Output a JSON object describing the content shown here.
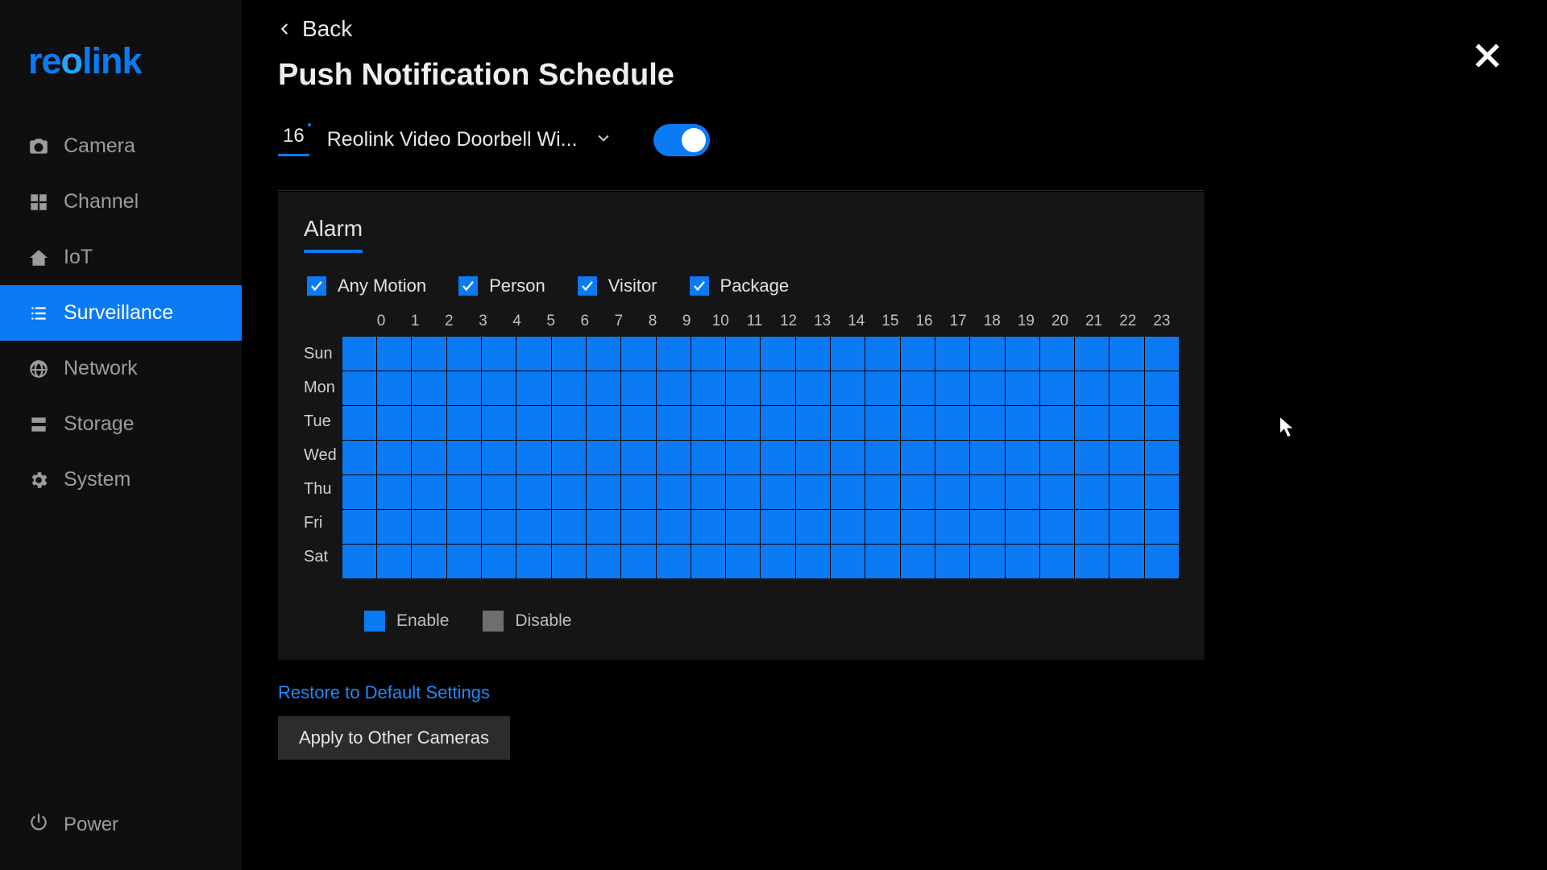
{
  "brand": "reolink",
  "sidebar": {
    "items": [
      {
        "label": "Camera"
      },
      {
        "label": "Channel"
      },
      {
        "label": "IoT"
      },
      {
        "label": "Surveillance"
      },
      {
        "label": "Network"
      },
      {
        "label": "Storage"
      },
      {
        "label": "System"
      }
    ],
    "power": "Power"
  },
  "header": {
    "back": "Back",
    "title": "Push Notification Schedule"
  },
  "device": {
    "channel": "16",
    "name": "Reolink Video Doorbell Wi...",
    "toggle": true
  },
  "alarm": {
    "tab": "Alarm",
    "checks": [
      {
        "label": "Any Motion",
        "checked": true
      },
      {
        "label": "Person",
        "checked": true
      },
      {
        "label": "Visitor",
        "checked": true
      },
      {
        "label": "Package",
        "checked": true
      }
    ],
    "hours": [
      "0",
      "1",
      "2",
      "3",
      "4",
      "5",
      "6",
      "7",
      "8",
      "9",
      "10",
      "11",
      "12",
      "13",
      "14",
      "15",
      "16",
      "17",
      "18",
      "19",
      "20",
      "21",
      "22",
      "23"
    ],
    "days": [
      "Sun",
      "Mon",
      "Tue",
      "Wed",
      "Thu",
      "Fri",
      "Sat"
    ],
    "legend": {
      "enable": "Enable",
      "disable": "Disable"
    }
  },
  "footer": {
    "restore": "Restore to Default Settings",
    "apply": "Apply to Other Cameras"
  },
  "colors": {
    "accent": "#0a7af5"
  }
}
